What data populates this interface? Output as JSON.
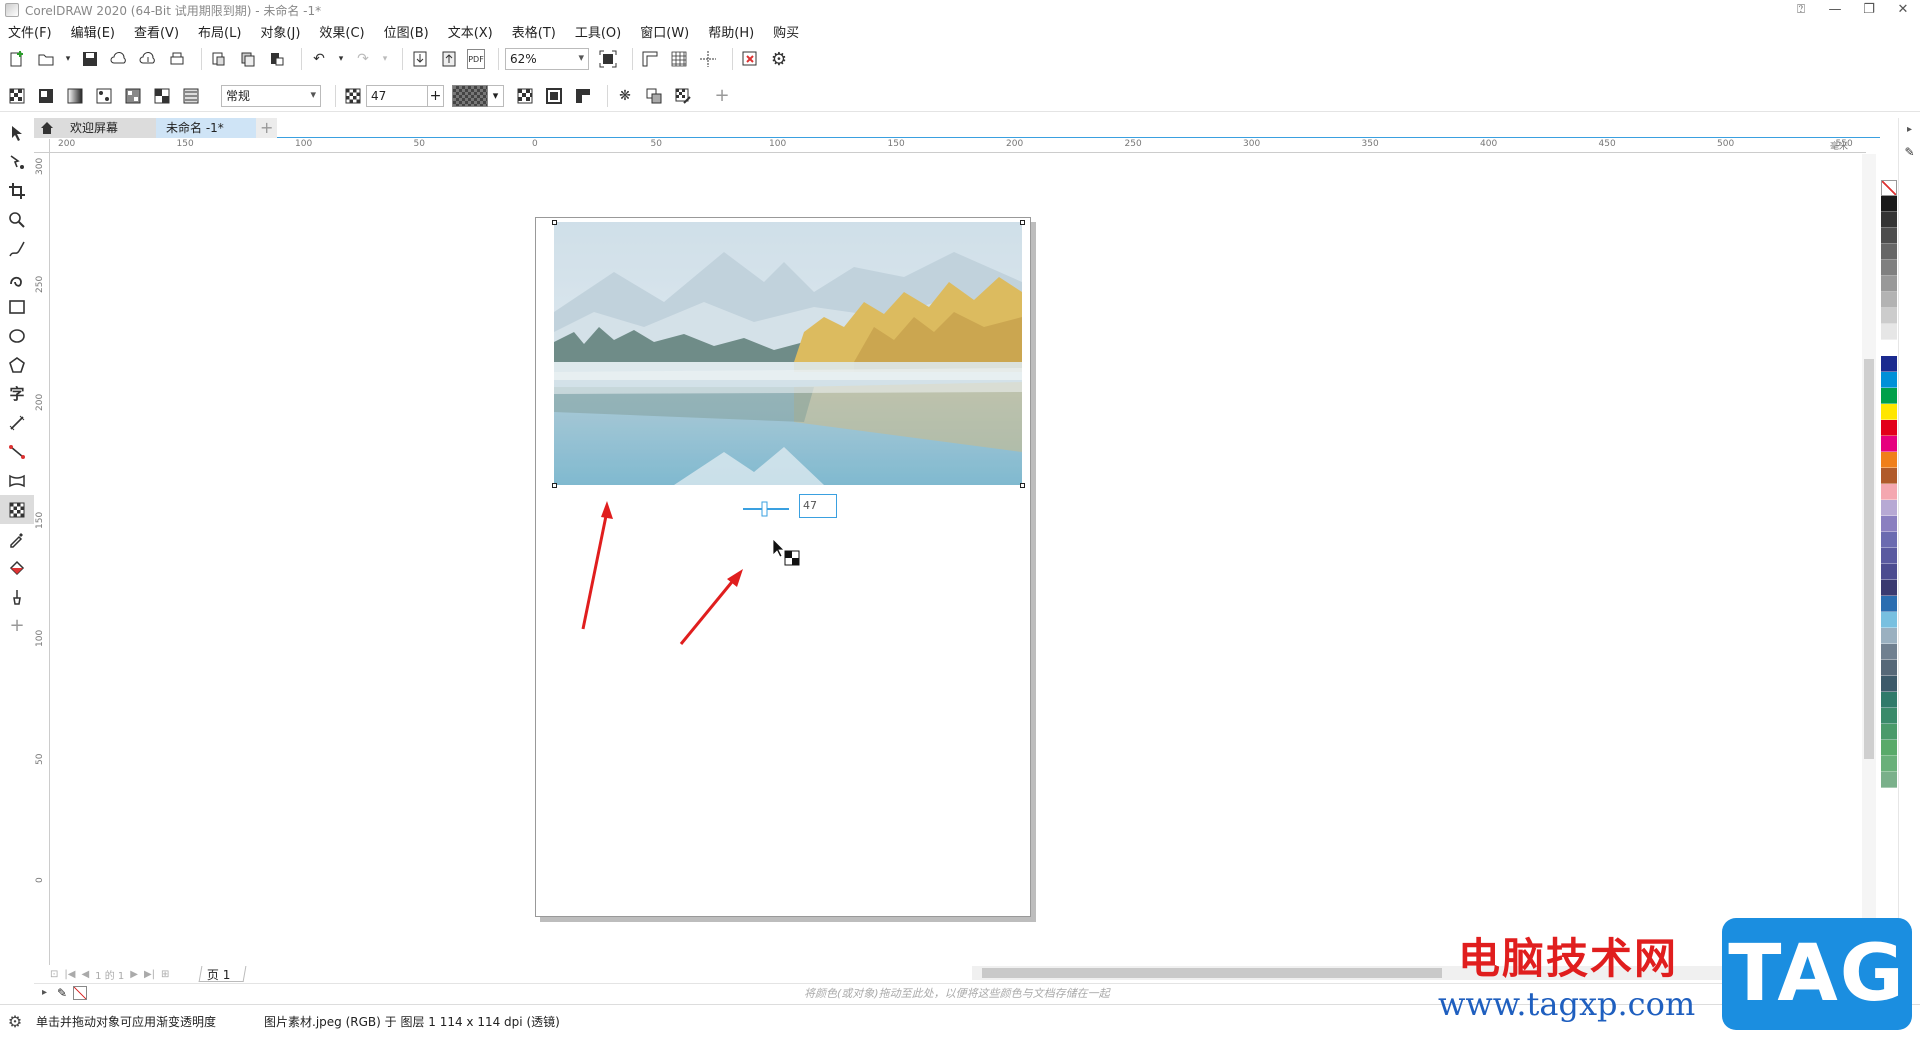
{
  "window": {
    "title": "CorelDRAW 2020 (64-Bit 试用期限到期) - 未命名 -1*"
  },
  "menu": [
    "文件(F)",
    "编辑(E)",
    "查看(V)",
    "布局(L)",
    "对象(J)",
    "效果(C)",
    "位图(B)",
    "文本(X)",
    "表格(T)",
    "工具(O)",
    "窗口(W)",
    "帮助(H)",
    "购买"
  ],
  "toolbar1": {
    "zoom": "62%"
  },
  "toolbar2": {
    "merge_mode": "常规",
    "transparency_value": "47"
  },
  "tabs": {
    "welcome": "欢迎屏幕",
    "document": "未命名 -1*"
  },
  "ruler": {
    "h_labels": [
      "200",
      "150",
      "100",
      "50",
      "0",
      "50",
      "100",
      "150",
      "200",
      "250",
      "300",
      "350",
      "400",
      "450",
      "500",
      "550",
      "毫米"
    ],
    "v_labels": [
      "300",
      "250",
      "200",
      "150",
      "100",
      "50",
      "0"
    ]
  },
  "canvas": {
    "transparency_value": "47"
  },
  "page_nav": {
    "page_info": "1 的 1",
    "page_tab": "页 1"
  },
  "doc_palette": {
    "hint": "将颜色(或对象)拖动至此处，以便将这些颜色与文档存储在一起"
  },
  "status": {
    "hint": "单击并拖动对象可应用渐变透明度",
    "info": "图片素材.jpeg (RGB) 于 图层 1 114 x 114 dpi (透镜)"
  },
  "watermark": {
    "text": "电脑技术网",
    "url": "www.tagxp.com",
    "logo": "TAG"
  },
  "palette_colors": [
    "#ffffff",
    "#1a1a1a",
    "#333333",
    "#4d4d4d",
    "#666666",
    "#808080",
    "#999999",
    "#b3b3b3",
    "#cccccc",
    "#e6e6e6",
    "#ffffff",
    "#1b2b8f",
    "#0090d8",
    "#00a04a",
    "#ffe600",
    "#e2001a",
    "#e6007e",
    "#f07f1a",
    "#b05a2a",
    "#f4a7b0",
    "#b7a9d4",
    "#8a7fc0",
    "#6b6bb0",
    "#5a5aa0",
    "#4c4c90",
    "#3a3a70",
    "#2a6db0",
    "#78c0e0",
    "#9ab0c0",
    "#708090",
    "#566878",
    "#3c5a6a",
    "#2f7a6a",
    "#3a8a6a",
    "#4a9a6a",
    "#5aaa6a",
    "#6ab07a",
    "#7ab08a"
  ],
  "colors": {
    "accent": "#3aa0e0",
    "arrow": "#e01e1e"
  }
}
